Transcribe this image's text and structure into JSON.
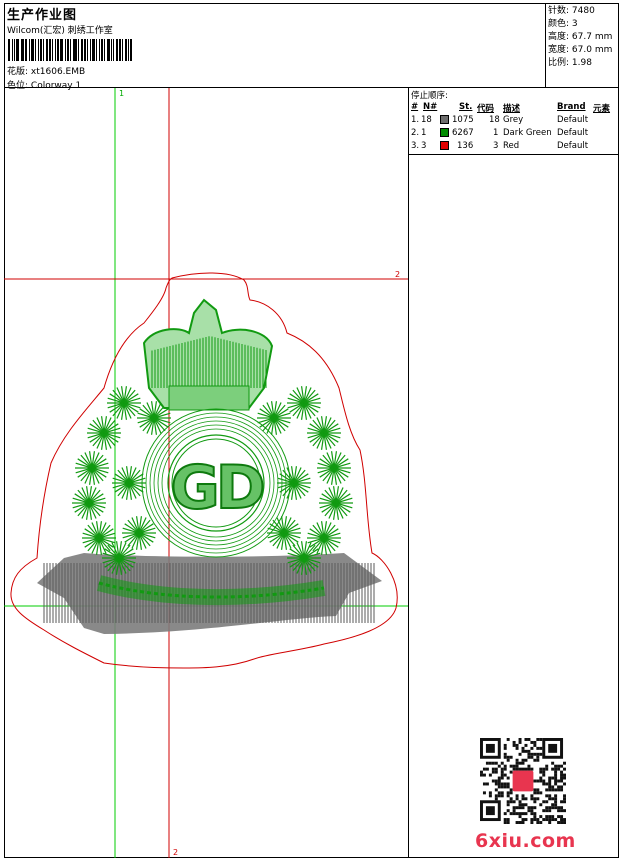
{
  "header": {
    "title": "生产作业图",
    "company": "Wilcom(汇宏) 刺绣工作室",
    "design_label": "花版:",
    "design_value": "xt1606.EMB",
    "color_label": "色位:",
    "color_value": "Colorway 1"
  },
  "stats": {
    "stitches_label": "针数:",
    "stitches_value": "7480",
    "colors_label": "颜色:",
    "colors_value": "3",
    "height_label": "高度:",
    "height_value": "67.7 mm",
    "width_label": "宽度:",
    "width_value": "67.0 mm",
    "ratio_label": "比例:",
    "ratio_value": "1.98"
  },
  "stop_sequence": {
    "title": "停止顺序:",
    "headers": {
      "num": "#",
      "needle": "N#",
      "stitches": "St.",
      "code": "代码",
      "description": "描述",
      "brand": "Brand",
      "element": "元素"
    },
    "rows": [
      {
        "index": "1.",
        "needle": "18",
        "color": "#6e6e6e",
        "stitches": "1075",
        "code": "18",
        "description": "Grey",
        "brand": "Default"
      },
      {
        "index": "2.",
        "needle": "1",
        "color": "#008c00",
        "stitches": "6267",
        "code": "1",
        "description": "Dark Green",
        "brand": "Default"
      },
      {
        "index": "3.",
        "needle": "3",
        "color": "#e00000",
        "stitches": "136",
        "code": "3",
        "description": "Red",
        "brand": "Default"
      }
    ]
  },
  "canvas": {
    "guide_label_1": "1",
    "guide_label_2": "2",
    "badge_text": "GD",
    "colors": {
      "outline": "#d00000",
      "green": "#119a11",
      "grey": "#7a7a7a",
      "guide_green": "#00cc00",
      "guide_red": "#d00000"
    }
  },
  "watermark": "6xiu.com"
}
